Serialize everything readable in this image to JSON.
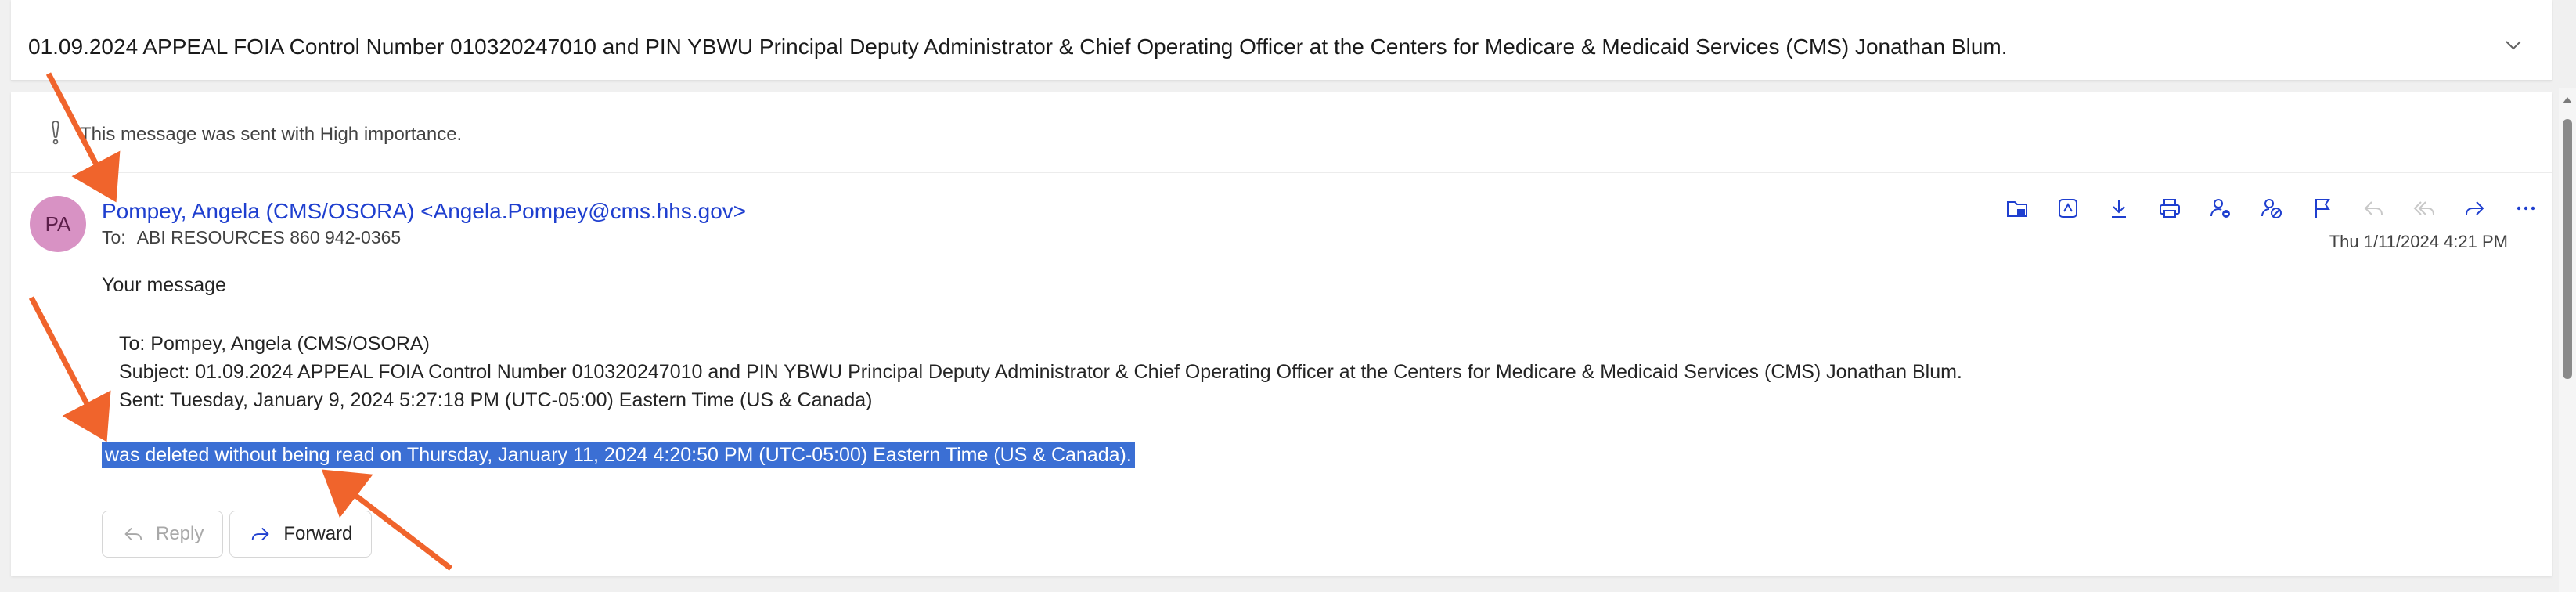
{
  "subject": {
    "title": "01.09.2024 APPEAL FOIA Control Number 010320247010 and PIN YBWU Principal Deputy Administrator & Chief Operating Officer at the Centers for Medicare & Medicaid Services (CMS) Jonathan Blum."
  },
  "message": {
    "importance_notice": "This message was sent with High importance.",
    "avatar_initials": "PA",
    "avatar_color": "#d892c4",
    "sender": "Pompey, Angela (CMS/OSORA) <Angela.Pompey@cms.hhs.gov>",
    "to_label": "To:",
    "to_value": "ABI RESOURCES 860 942-0365",
    "date": "Thu 1/11/2024 4:21 PM",
    "body": {
      "intro": "Your message",
      "quoted_to": "To: Pompey, Angela (CMS/OSORA)",
      "quoted_subject": "Subject: 01.09.2024 APPEAL FOIA Control Number 010320247010 and PIN YBWU Principal Deputy Administrator & Chief Operating Officer at the Centers for Medicare & Medicaid Services (CMS) Jonathan Blum.",
      "quoted_sent": "Sent: Tuesday, January 9, 2024 5:27:18 PM (UTC-05:00) Eastern Time (US & Canada)",
      "deleted_notice": "was deleted without being read on Thursday, January 11, 2024 4:20:50 PM (UTC-05:00) Eastern Time (US & Canada)."
    },
    "actions": {
      "reply_label": "Reply",
      "forward_label": "Forward"
    }
  },
  "toolbar_icons": [
    "move-to-folder-icon",
    "immersive-reader-icon",
    "download-icon",
    "print-icon",
    "block-sender-icon",
    "report-icon",
    "flag-icon",
    "reply-icon",
    "reply-all-icon",
    "forward-icon",
    "more-icon"
  ],
  "colors": {
    "accent": "#1f3fcf",
    "highlight": "#3b6fd4",
    "annotation_arrow": "#f0642c"
  }
}
